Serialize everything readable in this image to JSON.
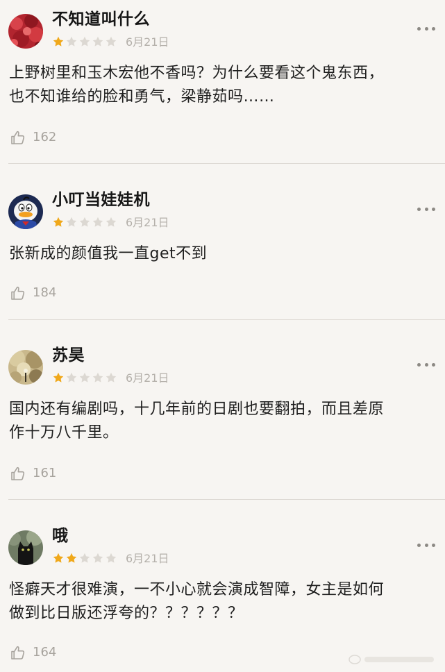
{
  "colors": {
    "background": "#f7f5f2",
    "star_filled": "#f0a81a",
    "star_empty": "#dcd8d2",
    "date_text": "#b4b0aa",
    "like_text": "#a7a39d"
  },
  "icons": {
    "like": "thumbs-up-outline-icon",
    "more": "more-dots-icon",
    "star": "star-icon"
  },
  "comments": [
    {
      "username": "不知道叫什么",
      "rating": 1,
      "rating_max": 5,
      "date": "6月21日",
      "content_lines": [
        "上野树里和玉木宏他不香吗？为什么要看这个鬼东西，",
        "也不知谁给的脸和勇气，梁静茹吗……"
      ],
      "likes": "162"
    },
    {
      "username": "小叮当娃娃机",
      "rating": 1,
      "rating_max": 5,
      "date": "6月21日",
      "content_lines": [
        "张新成的颜值我一直get不到"
      ],
      "likes": "184"
    },
    {
      "username": "苏昊",
      "rating": 1,
      "rating_max": 5,
      "date": "6月21日",
      "content_lines": [
        "国内还有编剧吗，十几年前的日剧也要翻拍，而且差原",
        "作十万八千里。"
      ],
      "likes": "161"
    },
    {
      "username": "哦",
      "rating": 2,
      "rating_max": 5,
      "date": "6月21日",
      "content_lines": [
        "怪癖天才很难演，一不小心就会演成智障，女主是如何",
        "做到比日版还浮夸的？？？？？？"
      ],
      "likes": "164"
    }
  ]
}
